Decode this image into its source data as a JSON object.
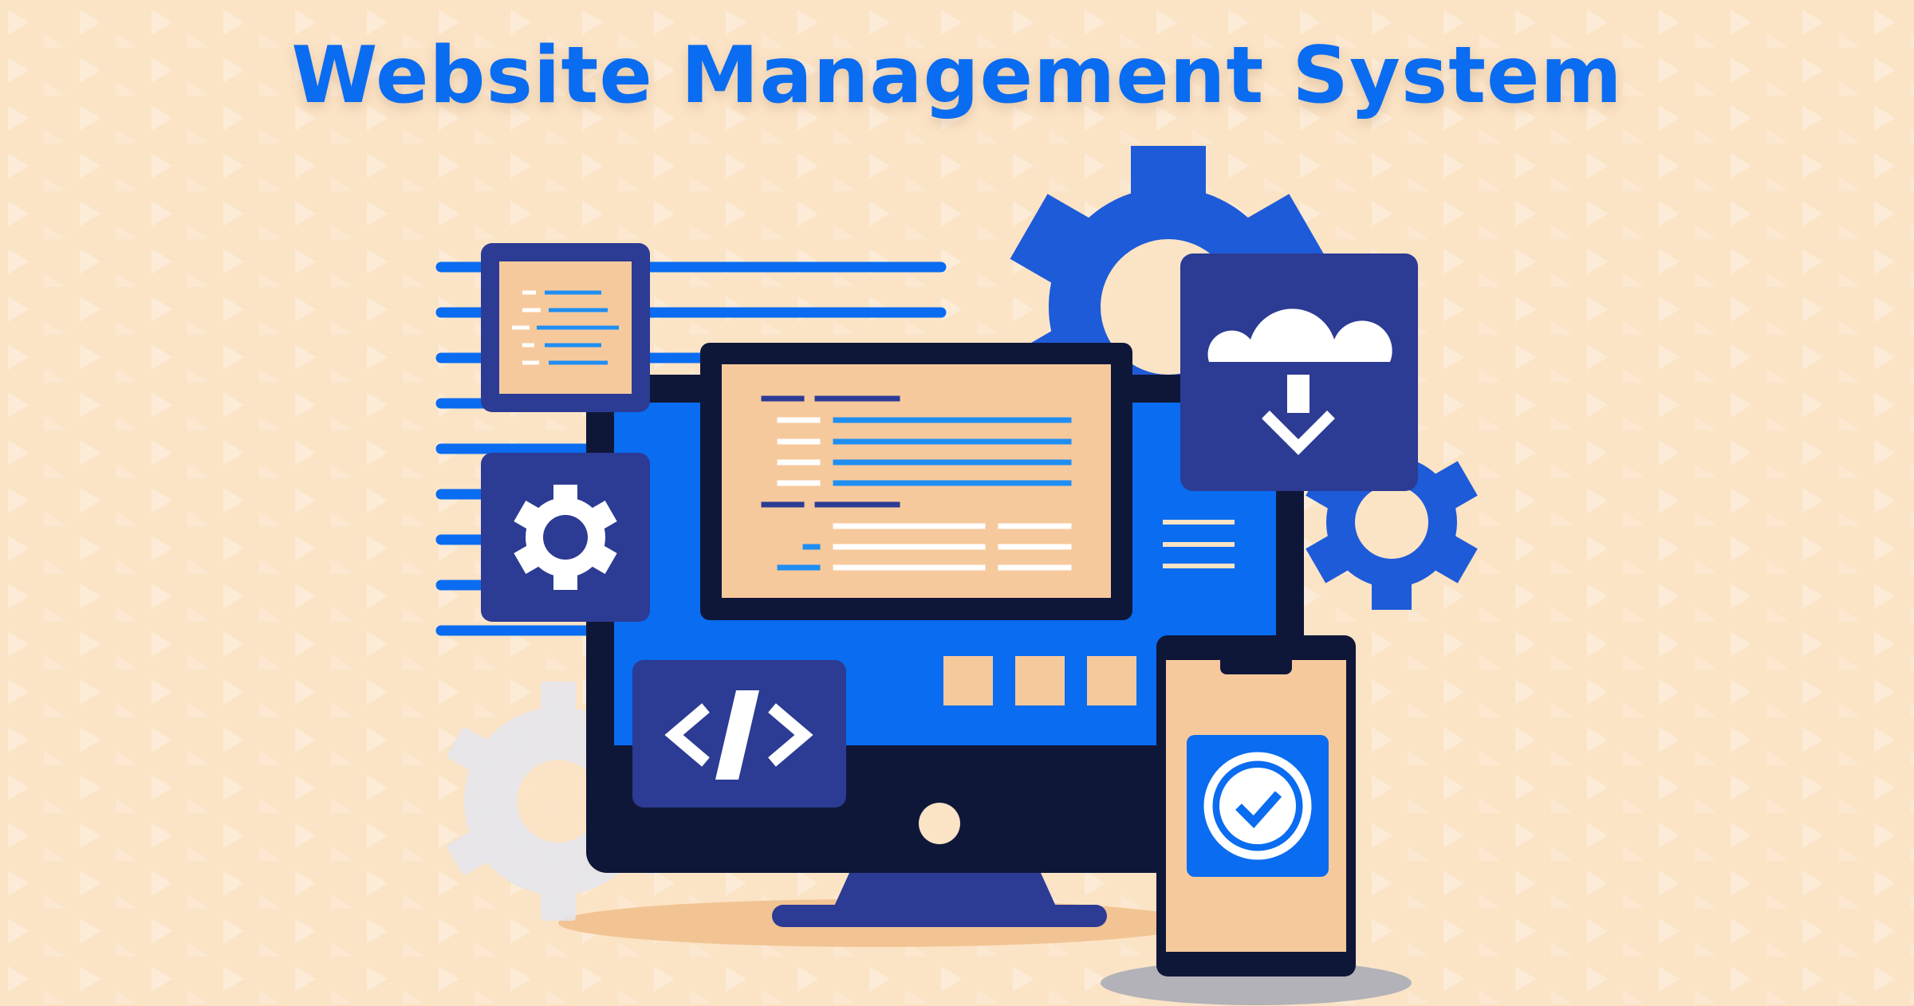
{
  "title": "Website Management System",
  "colors": {
    "background": "#fbe3c6",
    "brand_blue": "#0a6cf0",
    "navy": "#2c3b93",
    "dark": "#0f1739",
    "peach": "#f6c99c",
    "white": "#ffffff"
  },
  "icons": [
    "gear-icon",
    "cloud-download-icon",
    "code-icon",
    "check-circle-icon",
    "document-icon",
    "monitor-icon",
    "smartphone-icon"
  ]
}
